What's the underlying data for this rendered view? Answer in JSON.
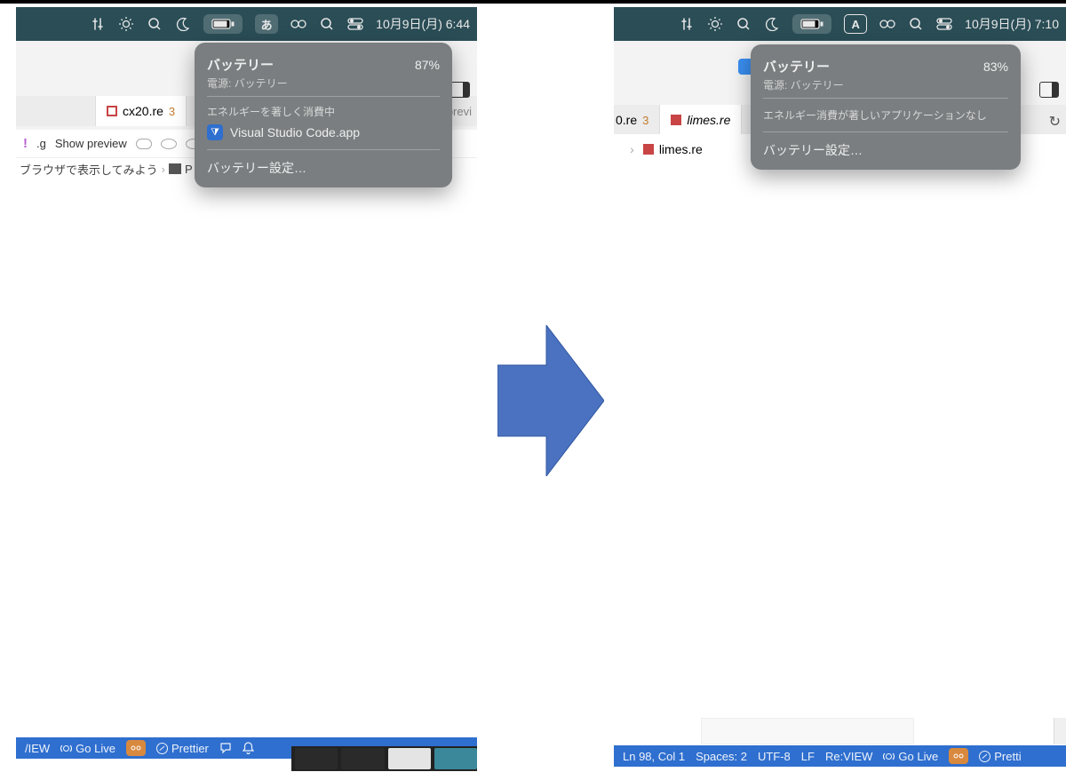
{
  "left": {
    "menubar": {
      "ime": "あ",
      "datetime": "10月9日(月)  6:44"
    },
    "popover": {
      "title": "バッテリー",
      "percent": "87%",
      "source": "電源: バッテリー",
      "section": "エネルギーを著しく消費中",
      "app": "Visual Studio Code.app",
      "settings": "バッテリー設定…"
    },
    "tab": {
      "name": "cx20.re",
      "badge": "3"
    },
    "subbar": {
      "g": ".g",
      "preview": "Show preview"
    },
    "breadcrumb": {
      "text": "ブラウザで表示してみよう",
      "after": "P"
    },
    "status": {
      "view": "/IEW",
      "golive": "Go Live",
      "prettier": "Prettier"
    }
  },
  "right": {
    "menubar": {
      "ime": "A",
      "datetime": "10月9日(月)  7:10"
    },
    "popover": {
      "title": "バッテリー",
      "percent": "83%",
      "source": "電源: バッテリー",
      "section": "エネルギー消費が著しいアプリケーションなし",
      "settings": "バッテリー設定…"
    },
    "tab1": {
      "name": "0.re",
      "badge": "3"
    },
    "tab2": {
      "name": "limes.re"
    },
    "subtab": {
      "name": "limes.re"
    },
    "status": {
      "pos": "Ln 98, Col 1",
      "spaces": "Spaces: 2",
      "enc": "UTF-8",
      "eol": "LF",
      "lang": "Re:VIEW",
      "golive": "Go Live",
      "prettier": "Pretti"
    }
  }
}
